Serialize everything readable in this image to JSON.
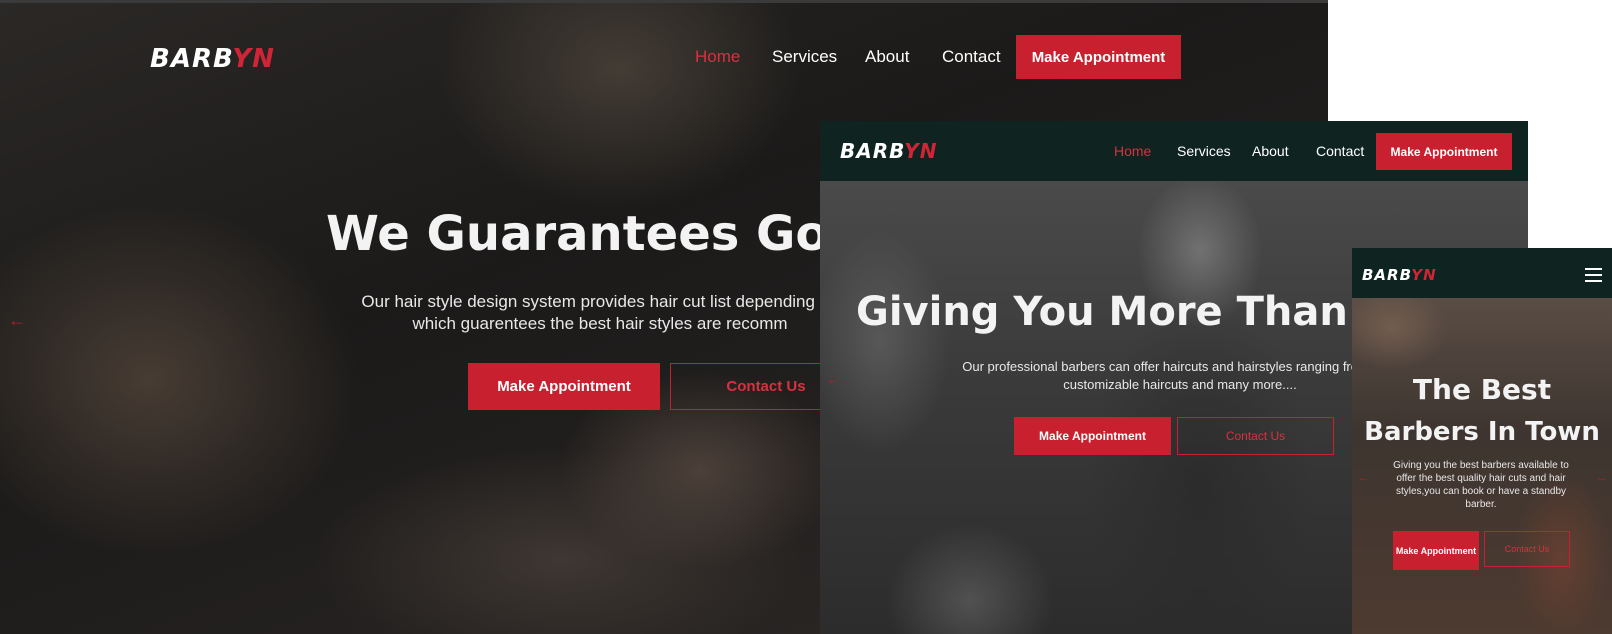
{
  "colors": {
    "accent": "#c8202f",
    "nav_dark": "#0f2420",
    "overlay": "#1a1a1a"
  },
  "brand": {
    "logo_main": "BARB",
    "logo_accent": "YN"
  },
  "nav": {
    "home": "Home",
    "services": "Services",
    "about": "About",
    "contact": "Contact",
    "cta": "Make Appointment"
  },
  "desktop": {
    "hero_title": "We Guarantees Goo",
    "hero_line1": "Our hair style design system provides hair cut list depending on",
    "hero_line2": "which guarentees the best hair styles are recomm",
    "btn_primary": "Make Appointment",
    "btn_secondary": "Contact Us",
    "prev_icon": "arrow-left-icon"
  },
  "tablet": {
    "hero_title": "Giving You More Than A I",
    "hero_line1": "Our professional barbers can offer haircuts and hairstyles ranging from fade",
    "hero_line2": "customizable haircuts and many more....",
    "btn_primary": "Make Appointment",
    "btn_secondary": "Contact Us",
    "prev_icon": "arrow-left-icon"
  },
  "mobile": {
    "hero_title_line1": "The Best",
    "hero_title_line2": "Barbers In Town",
    "hero_text": "Giving you the best barbers available to offer the best quality hair cuts and hair styles,you can book or have a standby barber.",
    "btn_primary": "Make Appointment",
    "btn_secondary": "Contact Us",
    "menu_icon": "hamburger-menu-icon",
    "prev_icon": "arrow-left-icon",
    "next_icon": "arrow-right-icon"
  }
}
